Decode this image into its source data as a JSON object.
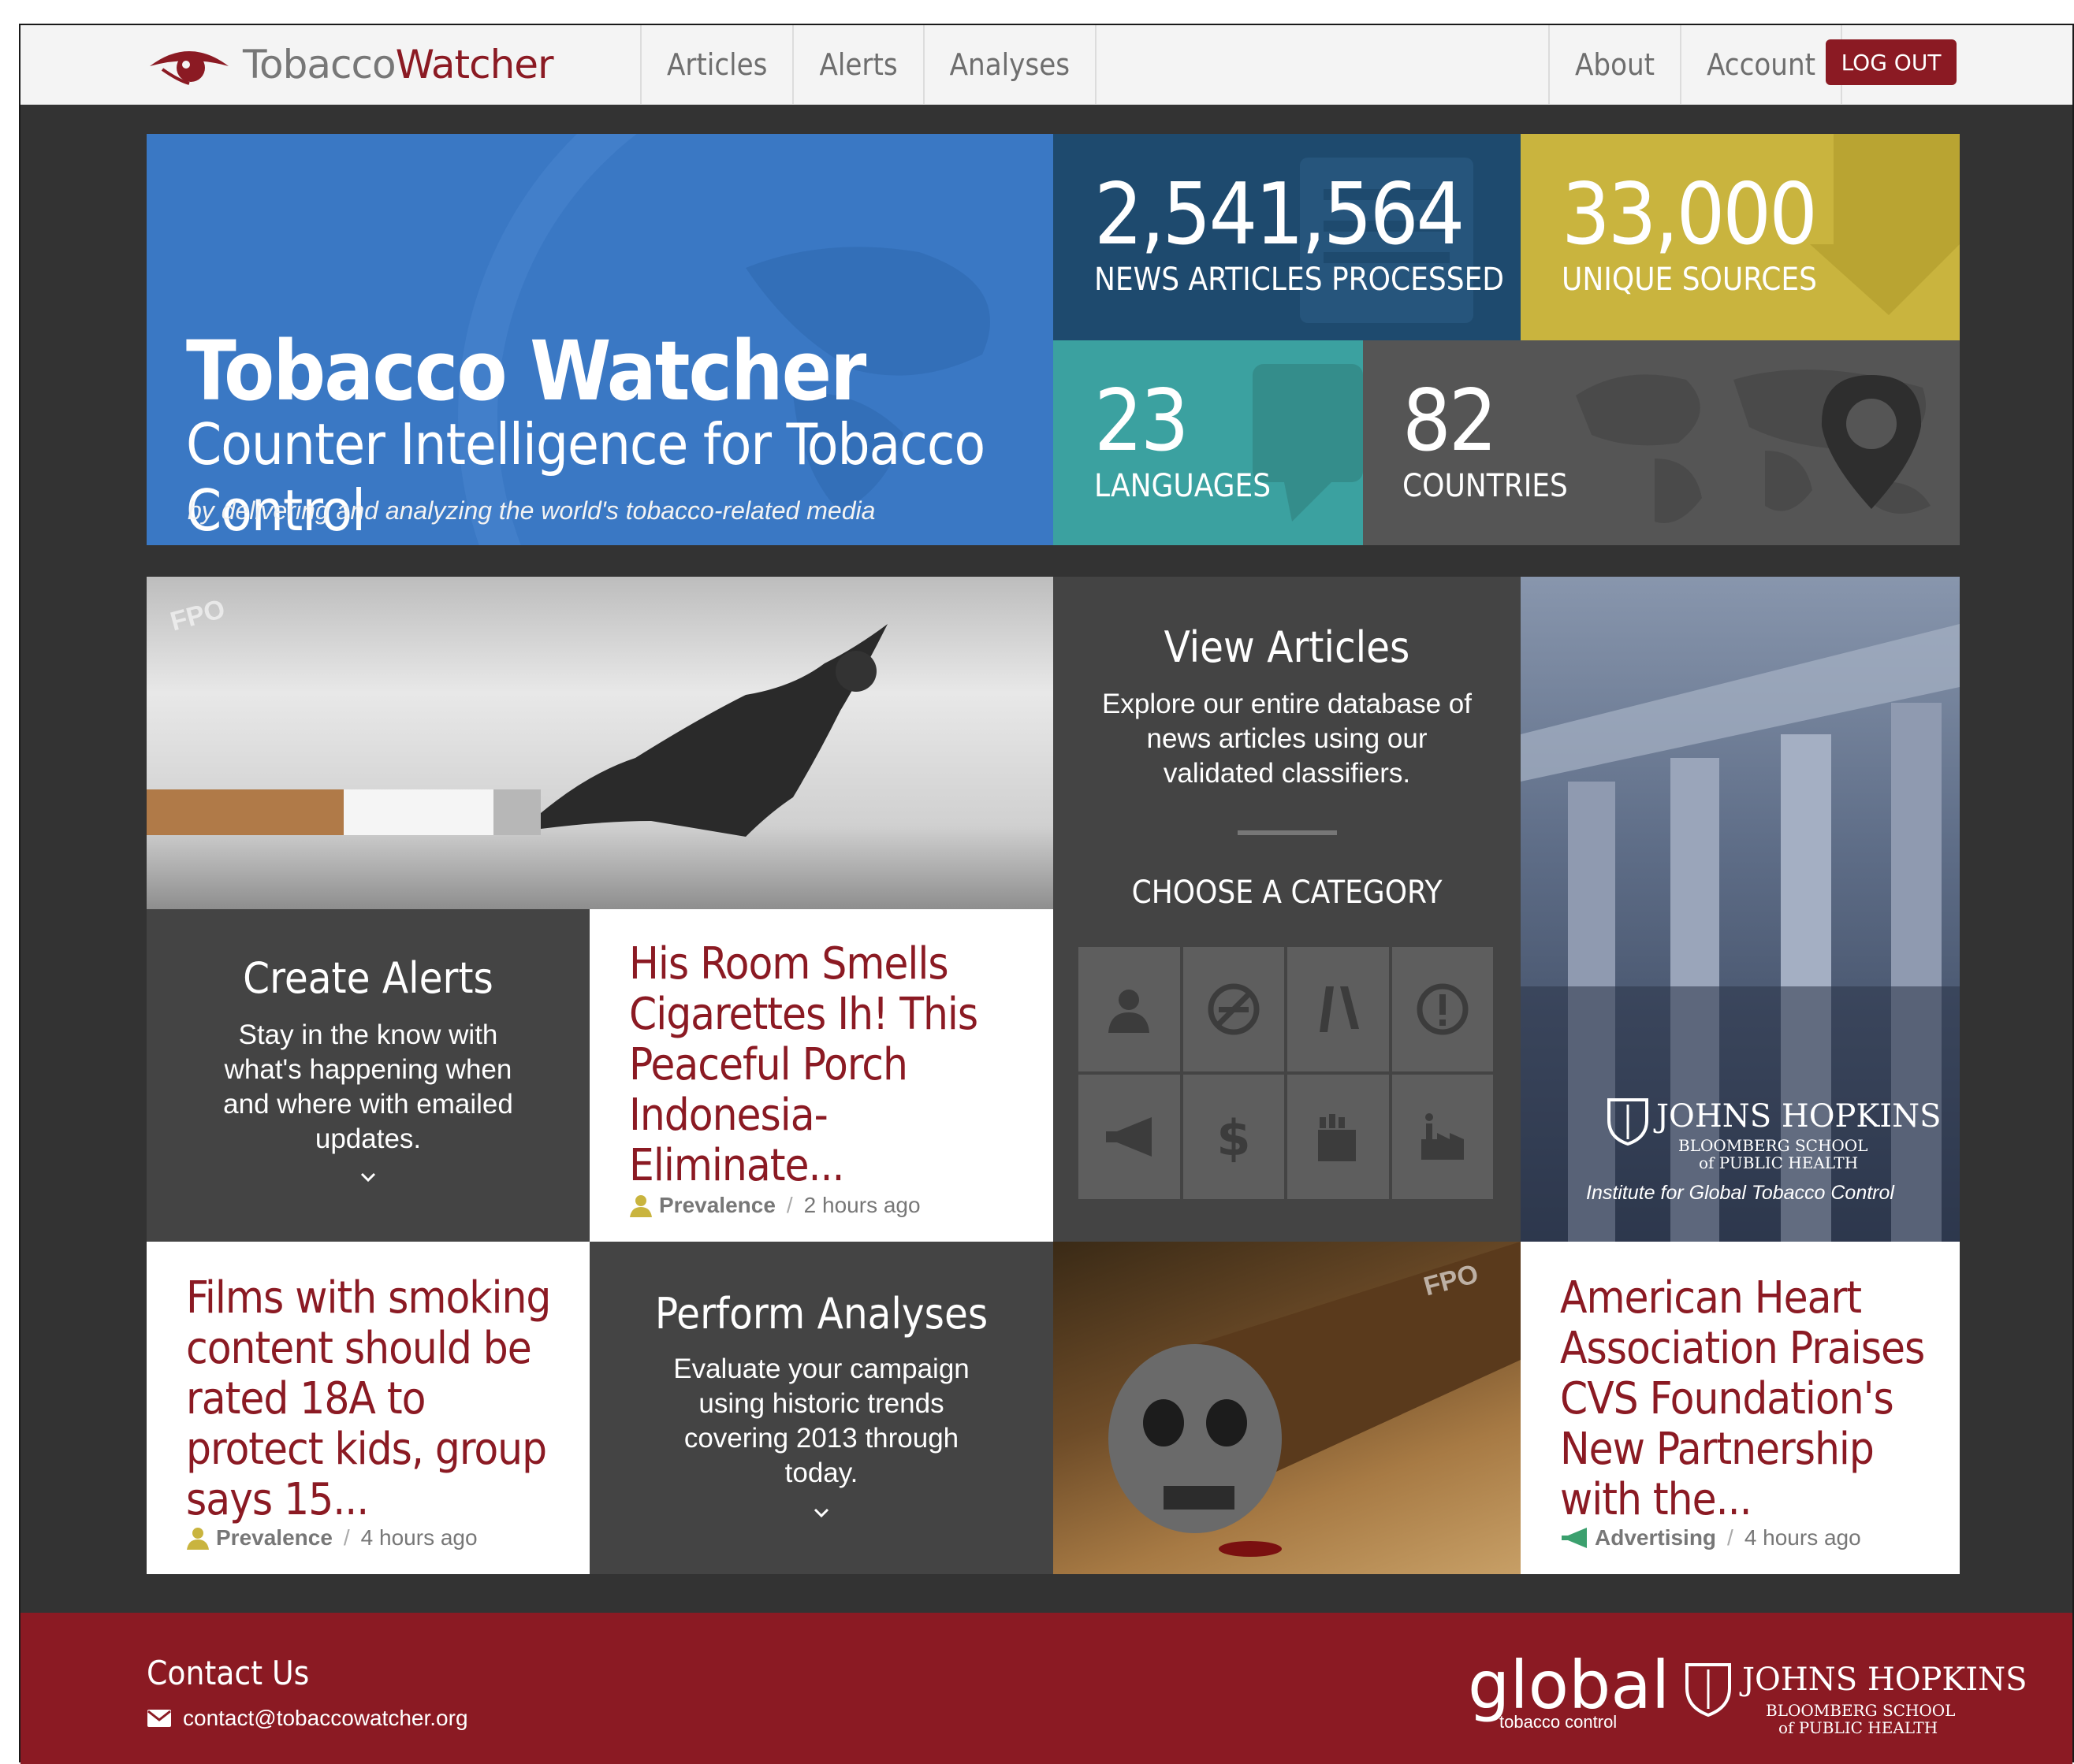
{
  "brand": {
    "name_part1": "Tobacco",
    "name_part2": "Watcher",
    "accent": "#8b1a23"
  },
  "nav": {
    "left": [
      "Articles",
      "Alerts",
      "Analyses"
    ],
    "right": [
      "About",
      "Account"
    ],
    "logout": "LOG OUT"
  },
  "hero": {
    "title": "Tobacco Watcher",
    "subtitle": "Counter Intelligence for Tobacco Control",
    "tagline": "by delivering and analyzing the world's tobacco-related media"
  },
  "stats": [
    {
      "value": "2,541,564",
      "label": "NEWS ARTICLES PROCESSED",
      "color": "#1e4a6e"
    },
    {
      "value": "33,000",
      "label": "UNIQUE SOURCES",
      "color": "#c9b43e"
    },
    {
      "value": "23",
      "label": "LANGUAGES",
      "color": "#3ba1a0"
    },
    {
      "value": "82",
      "label": "COUNTRIES",
      "color": "#555555"
    }
  ],
  "fpo_label": "FPO",
  "view_articles": {
    "title": "View Articles",
    "body": "Explore our entire database of news articles using our validated classifiers.",
    "category_heading": "CHOOSE A CATEGORY",
    "categories": [
      "person-icon",
      "no-smoking-icon",
      "cigarettes-icon",
      "alert-icon",
      "megaphone-icon",
      "dollar-icon",
      "pack-icon",
      "factory-icon"
    ]
  },
  "create_alerts": {
    "title": "Create Alerts",
    "body": "Stay in the know with what's happening when and where with emailed updates."
  },
  "perform_analyses": {
    "title": "Perform Analyses",
    "body": "Evaluate your campaign using historic trends covering 2013 through today."
  },
  "articles": [
    {
      "title": "His Room Smells Cigarettes Ih! This Peaceful Porch Indonesia-Eliminate...",
      "category": "Prevalence",
      "time": "2 hours ago"
    },
    {
      "title": "Films with smoking content should be rated 18A to protect kids, group says 15...",
      "category": "Prevalence",
      "time": "4 hours ago"
    },
    {
      "title": "American Heart Association Praises CVS Foundation's New Partnership with the...",
      "category": "Advertising",
      "time": "4 hours ago"
    }
  ],
  "jhu_tile": {
    "name": "JOHNS HOPKINS",
    "school": "BLOOMBERG SCHOOL",
    "school2": "of PUBLIC HEALTH",
    "institute": "Institute for Global Tobacco Control"
  },
  "footer": {
    "contact_heading": "Contact Us",
    "email": "contact@tobaccowatcher.org",
    "global_logo": "global",
    "global_sub": "tobacco control",
    "jhu_name": "JOHNS HOPKINS",
    "jhu_school": "BLOOMBERG SCHOOL",
    "jhu_school2": "of PUBLIC HEALTH"
  }
}
